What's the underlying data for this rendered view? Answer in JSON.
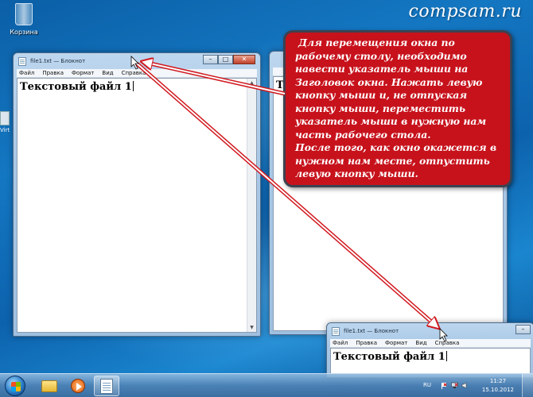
{
  "watermark": "compsam.ru",
  "desktop": {
    "recycle_bin_label": "Корзина",
    "side_icon_label": "Virt"
  },
  "window_main": {
    "title": "file1.txt — Блокнот",
    "menu": [
      "Файл",
      "Правка",
      "Формат",
      "Вид",
      "Справка"
    ],
    "content": "Текстовый файл 1"
  },
  "window_back": {
    "content": "Т"
  },
  "window_moved": {
    "title": "file1.txt — Блокнот",
    "menu": [
      "Файл",
      "Правка",
      "Формат",
      "Вид",
      "Справка"
    ],
    "content": "Текстовый файл 1"
  },
  "callout": {
    "paragraph1": "Для перемещения окна по рабочему столу, необходимо навести указатель мыши на Заголовок окна. Нажать левую кнопку мыши и, не отпуская кнопку мыши, переместить указатель мыши в нужную нам часть рабочего стола.",
    "paragraph2": "После того, как окно окажется в нужном нам месте, отпустить левую кнопку мыши."
  },
  "taskbar": {
    "language": "RU",
    "time": "11:27",
    "date": "15.10.2012"
  },
  "colors": {
    "callout_bg": "#c7121c",
    "arrow": "#d11a20",
    "desktop": "#1477c2"
  },
  "icons": [
    "recycle-bin-icon",
    "notepad-icon",
    "folder-icon",
    "media-player-icon",
    "cursor-arrow-icon",
    "flag-icon",
    "speaker-icon",
    "network-icon"
  ]
}
